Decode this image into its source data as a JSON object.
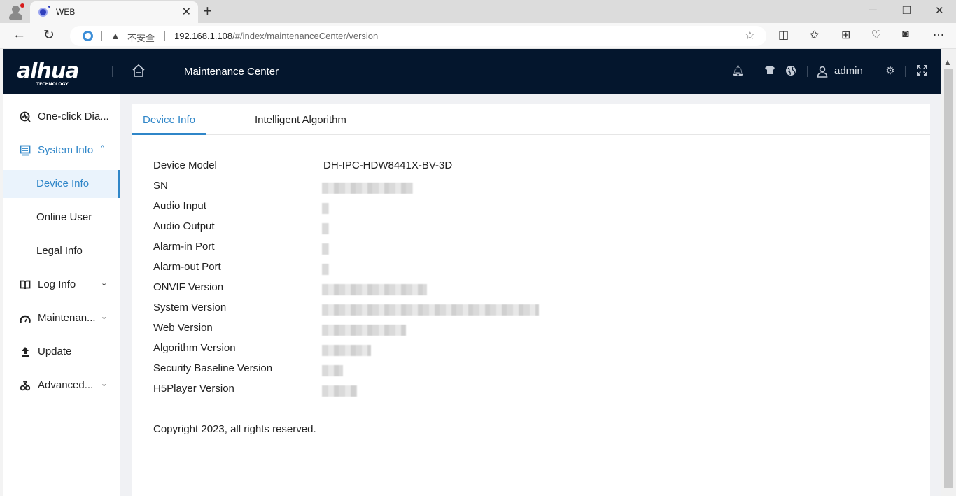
{
  "browser": {
    "tab_title": "WEB",
    "security_label": "不安全",
    "url_host": "192.168.1.108",
    "url_path": "/#/index/maintenanceCenter/version",
    "icons": [
      "profile-icon",
      "back-icon",
      "reload-icon",
      "ie-mode-icon",
      "warning-icon",
      "favorite-star-icon",
      "split-screen-icon",
      "favorites-icon",
      "collections-icon",
      "performance-icon",
      "copilot-icon",
      "more-icon"
    ]
  },
  "header": {
    "brand": "alhua",
    "brand_sub": "TECHNOLOGY",
    "title": "Maintenance Center",
    "username": "admin"
  },
  "sidebar": {
    "items": [
      {
        "label": "One-click Dia...",
        "icon": "diagnosis-icon",
        "expandable": false
      },
      {
        "label": "System Info",
        "icon": "system-info-icon",
        "expandable": true,
        "expanded": true,
        "children": [
          {
            "label": "Device Info",
            "active": true
          },
          {
            "label": "Online User",
            "active": false
          },
          {
            "label": "Legal Info",
            "active": false
          }
        ]
      },
      {
        "label": "Log Info",
        "icon": "book-icon",
        "expandable": true,
        "expanded": false
      },
      {
        "label": "Maintenan...",
        "icon": "gauge-icon",
        "expandable": true,
        "expanded": false
      },
      {
        "label": "Update",
        "icon": "upload-icon",
        "expandable": false
      },
      {
        "label": "Advanced...",
        "icon": "advanced-icon",
        "expandable": true,
        "expanded": false
      }
    ]
  },
  "main": {
    "tabs": [
      {
        "label": "Device Info",
        "active": true
      },
      {
        "label": "Intelligent Algorithm",
        "active": false
      }
    ],
    "fields": [
      {
        "label": "Device Model",
        "value": "DH-IPC-HDW8441X-BV-3D",
        "redacted": false
      },
      {
        "label": "SN",
        "value": "",
        "redacted": true
      },
      {
        "label": "Audio Input",
        "value": "",
        "redacted": true
      },
      {
        "label": "Audio Output",
        "value": "",
        "redacted": true
      },
      {
        "label": "Alarm-in Port",
        "value": "",
        "redacted": true
      },
      {
        "label": "Alarm-out Port",
        "value": "",
        "redacted": true
      },
      {
        "label": "ONVIF Version",
        "value": "",
        "redacted": true
      },
      {
        "label": "System Version",
        "value": "",
        "redacted": true
      },
      {
        "label": "Web Version",
        "value": "",
        "redacted": true
      },
      {
        "label": "Algorithm Version",
        "value": "",
        "redacted": true
      },
      {
        "label": "Security Baseline Version",
        "value": "",
        "redacted": true
      },
      {
        "label": "H5Player Version",
        "value": "",
        "redacted": true
      }
    ],
    "copyright": "Copyright 2023, all rights reserved."
  },
  "colors": {
    "accent": "#2f86c8",
    "header_bg": "#04162d",
    "active_sub_bg": "#eaf3fc"
  }
}
